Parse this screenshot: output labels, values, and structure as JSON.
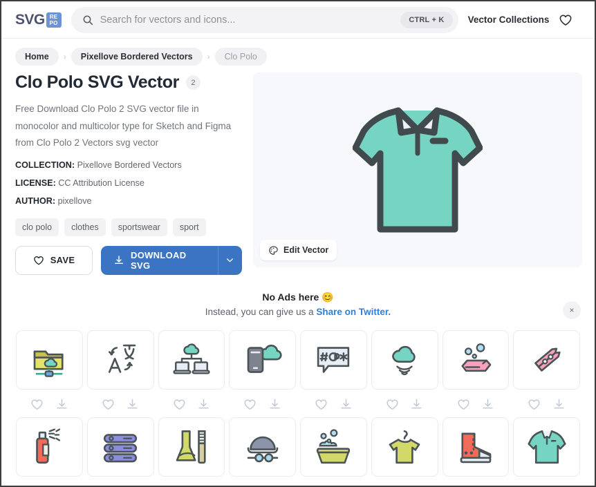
{
  "header": {
    "logo_text": "SVG",
    "logo_badge_top": "RE",
    "logo_badge_bottom": "PO",
    "search_placeholder": "Search for vectors and icons...",
    "search_value": "",
    "shortcut_chip": "CTRL + K",
    "nav_link": "Vector Collections",
    "favorites_icon": "heart-icon",
    "search_icon": "search-icon"
  },
  "breadcrumb": {
    "items": [
      {
        "label": "Home",
        "muted": false
      },
      {
        "label": "Pixellove Bordered Vectors",
        "muted": false
      },
      {
        "label": "Clo Polo",
        "muted": true
      }
    ],
    "separator": "›"
  },
  "detail": {
    "title": "Clo Polo SVG Vector",
    "count_badge": "2",
    "description": "Free Download Clo Polo 2 SVG vector file in monocolor and multicolor type for Sketch and Figma from Clo Polo 2 Vectors svg vector",
    "meta": [
      {
        "key": "COLLECTION:",
        "value": "Pixellove Bordered Vectors"
      },
      {
        "key": "LICENSE:",
        "value": "CC Attribution License"
      },
      {
        "key": "AUTHOR:",
        "value": "pixellove"
      }
    ],
    "tags": [
      "clo polo",
      "clothes",
      "sportswear",
      "sport"
    ],
    "save_label": "SAVE",
    "download_label": "DOWNLOAD SVG",
    "edit_label": "Edit Vector",
    "colors": {
      "accent_blue": "#3c74c4",
      "shirt_fill": "#76d4c3",
      "shirt_stroke": "#414b4e",
      "preview_bg": "#f7f8fb"
    }
  },
  "ads": {
    "title": "No Ads here 😊",
    "sub_prefix": "Instead, you can give us a ",
    "link": "Share on Twitter.",
    "close": "×"
  },
  "grid": {
    "items": [
      {
        "name": "cloud-folder-network-icon"
      },
      {
        "name": "translate-language-icon"
      },
      {
        "name": "cloud-network-diagram-icon"
      },
      {
        "name": "phone-cloud-icon"
      },
      {
        "name": "swear-speech-bubble-icon"
      },
      {
        "name": "cloud-wifi-icon"
      },
      {
        "name": "soap-bar-bubbles-icon"
      },
      {
        "name": "clothespin-icon"
      },
      {
        "name": "spray-can-icon"
      },
      {
        "name": "folded-towels-icon"
      },
      {
        "name": "dustpan-brush-icon"
      },
      {
        "name": "bowler-hat-glasses-icon"
      },
      {
        "name": "wash-basin-bubbles-icon"
      },
      {
        "name": "tshirt-hanger-icon"
      },
      {
        "name": "sneaker-icon"
      },
      {
        "name": "polo-shirt-icon"
      }
    ],
    "like_icon": "heart-icon",
    "download_icon": "download-icon"
  }
}
